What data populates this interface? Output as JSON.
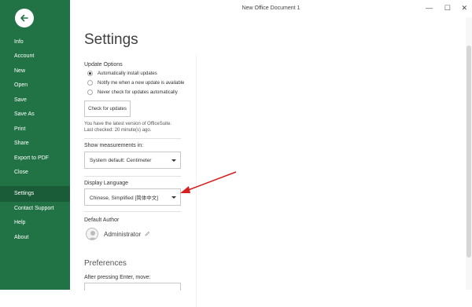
{
  "titlebar": {
    "title": "New Office Document 1",
    "minimize": "—",
    "maximize": "☐",
    "close": "✕"
  },
  "sidebar": {
    "back_icon": "arrow-left-icon",
    "items": [
      {
        "label": "Info"
      },
      {
        "label": "Account"
      },
      {
        "label": "New"
      },
      {
        "label": "Open"
      },
      {
        "label": "Save"
      },
      {
        "label": "Save As"
      },
      {
        "label": "Print"
      },
      {
        "label": "Share"
      },
      {
        "label": "Export to PDF"
      },
      {
        "label": "Close"
      },
      {
        "label": "Settings",
        "active": true
      },
      {
        "label": "Contact Support"
      },
      {
        "label": "Help"
      },
      {
        "label": "About"
      }
    ]
  },
  "settings": {
    "title": "Settings",
    "update": {
      "heading": "Update Options",
      "options": [
        {
          "label": "Automatically install updates",
          "checked": true
        },
        {
          "label": "Notify me when a new update is available",
          "checked": false
        },
        {
          "label": "Never check for updates automatically",
          "checked": false
        }
      ],
      "check_button": "Check for updates",
      "status_line1": "You have the latest version of OfficeSuite.",
      "status_line2": "Last checked: 20 minute(s) ago."
    },
    "measurements": {
      "heading": "Show measurements in:",
      "value": "System default: Centimeter"
    },
    "language": {
      "heading": "Display Language",
      "value": "Chinese, Simplified [简体中文]"
    },
    "author": {
      "heading": "Default Author",
      "name": "Administrator"
    },
    "preferences": {
      "heading": "Preferences",
      "enter_label": "After pressing Enter, move:"
    }
  },
  "colors": {
    "sidebar": "#217346",
    "sidebar_active": "#1a5c37",
    "annotation_arrow": "#d62020"
  }
}
